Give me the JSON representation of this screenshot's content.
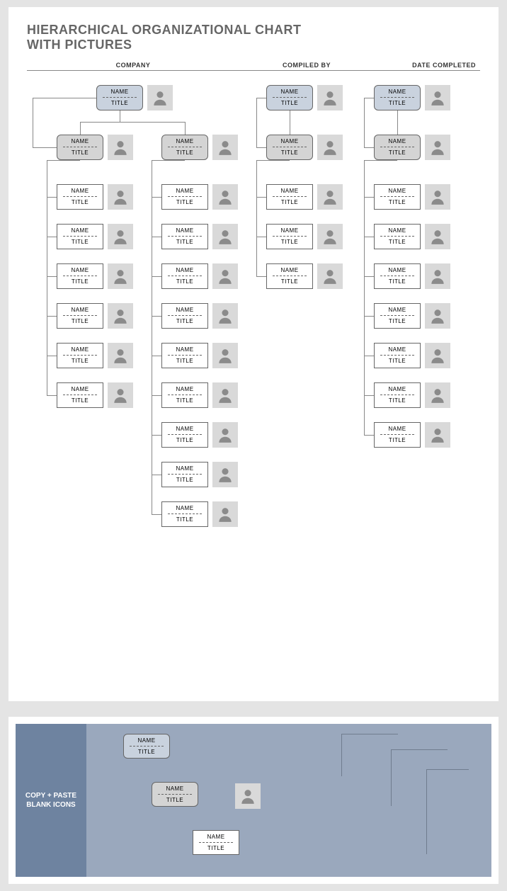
{
  "title_line1": "HIERARCHICAL ORGANIZATIONAL CHART",
  "title_line2": "WITH PICTURES",
  "headers": {
    "company": "COMPANY",
    "compiled": "COMPILED BY",
    "date": "DATE COMPLETED"
  },
  "labels": {
    "name": "NAME",
    "title": "TITLE"
  },
  "copy_paste": {
    "label_line1": "COPY + PASTE",
    "label_line2": "BLANK ICONS"
  },
  "chart_data": {
    "type": "table",
    "structure": "org-chart",
    "columns": [
      {
        "id": "A",
        "top": {
          "name": "NAME",
          "title": "TITLE",
          "style": "blue"
        },
        "managers": [
          {
            "id": "A1",
            "name": "NAME",
            "title": "TITLE",
            "style": "gray",
            "reports": [
              {
                "name": "NAME",
                "title": "TITLE"
              },
              {
                "name": "NAME",
                "title": "TITLE"
              },
              {
                "name": "NAME",
                "title": "TITLE"
              },
              {
                "name": "NAME",
                "title": "TITLE"
              },
              {
                "name": "NAME",
                "title": "TITLE"
              },
              {
                "name": "NAME",
                "title": "TITLE"
              }
            ]
          },
          {
            "id": "A2",
            "name": "NAME",
            "title": "TITLE",
            "style": "gray",
            "reports": [
              {
                "name": "NAME",
                "title": "TITLE"
              },
              {
                "name": "NAME",
                "title": "TITLE"
              },
              {
                "name": "NAME",
                "title": "TITLE"
              },
              {
                "name": "NAME",
                "title": "TITLE"
              },
              {
                "name": "NAME",
                "title": "TITLE"
              },
              {
                "name": "NAME",
                "title": "TITLE"
              },
              {
                "name": "NAME",
                "title": "TITLE"
              },
              {
                "name": "NAME",
                "title": "TITLE"
              },
              {
                "name": "NAME",
                "title": "TITLE"
              }
            ]
          }
        ]
      },
      {
        "id": "B",
        "top": {
          "name": "NAME",
          "title": "TITLE",
          "style": "blue"
        },
        "managers": [
          {
            "id": "B1",
            "name": "NAME",
            "title": "TITLE",
            "style": "gray",
            "reports": [
              {
                "name": "NAME",
                "title": "TITLE"
              },
              {
                "name": "NAME",
                "title": "TITLE"
              },
              {
                "name": "NAME",
                "title": "TITLE"
              }
            ]
          }
        ]
      },
      {
        "id": "C",
        "top": {
          "name": "NAME",
          "title": "TITLE",
          "style": "blue"
        },
        "managers": [
          {
            "id": "C1",
            "name": "NAME",
            "title": "TITLE",
            "style": "gray",
            "reports": [
              {
                "name": "NAME",
                "title": "TITLE"
              },
              {
                "name": "NAME",
                "title": "TITLE"
              },
              {
                "name": "NAME",
                "title": "TITLE"
              },
              {
                "name": "NAME",
                "title": "TITLE"
              },
              {
                "name": "NAME",
                "title": "TITLE"
              },
              {
                "name": "NAME",
                "title": "TITLE"
              },
              {
                "name": "NAME",
                "title": "TITLE"
              }
            ]
          }
        ]
      }
    ],
    "palette_samples": [
      {
        "name": "NAME",
        "title": "TITLE",
        "style": "blue"
      },
      {
        "name": "NAME",
        "title": "TITLE",
        "style": "gray"
      },
      {
        "name": "NAME",
        "title": "TITLE",
        "style": "white"
      }
    ]
  }
}
